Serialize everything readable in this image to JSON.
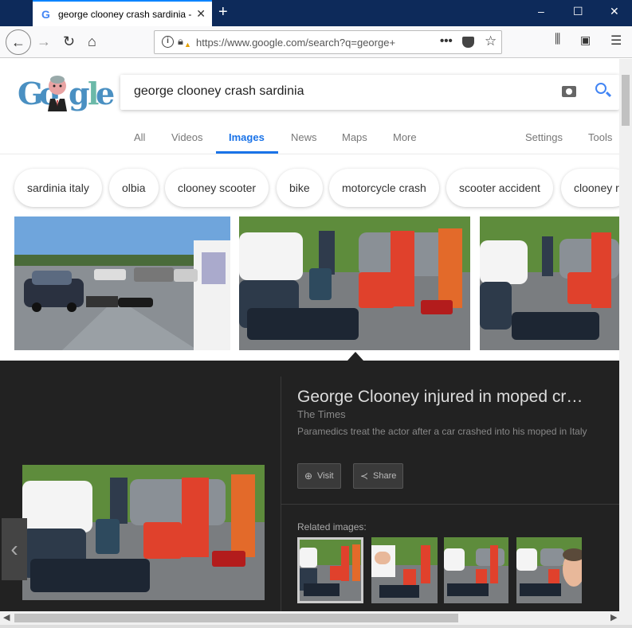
{
  "browser": {
    "tab_title": "george clooney crash sardinia -",
    "tab_favicon": "G",
    "url": "https://www.google.com/search?q=george+",
    "window_controls": [
      "–",
      "☐",
      "✕"
    ]
  },
  "google": {
    "logo_letters": [
      "G",
      "o",
      "o",
      "g",
      "l",
      "e"
    ],
    "logo_colors": [
      "#4a90c2",
      "#4a90c2",
      "#e8a3a3",
      "#4a90c2",
      "#6bb9a8",
      "#4a90c2"
    ],
    "query": "george clooney crash sardinia",
    "tabs": [
      "All",
      "Videos",
      "Images",
      "News",
      "Maps",
      "More"
    ],
    "active_tab": "Images",
    "right_tabs": [
      "Settings",
      "Tools"
    ],
    "chips": [
      "sardinia italy",
      "olbia",
      "clooney scooter",
      "bike",
      "motorcycle crash",
      "scooter accident",
      "clooney r"
    ]
  },
  "panel": {
    "title": "George Clooney injured in moped cr…",
    "source": "The Times",
    "description": "Paramedics treat the actor after a car crashed into his moped in Italy",
    "visit_label": "Visit",
    "share_label": "Share",
    "related_label": "Related images:"
  },
  "colors": {
    "accent": "#1a73e8",
    "panel_bg": "#222222",
    "titlebar": "#0d2a5a"
  }
}
